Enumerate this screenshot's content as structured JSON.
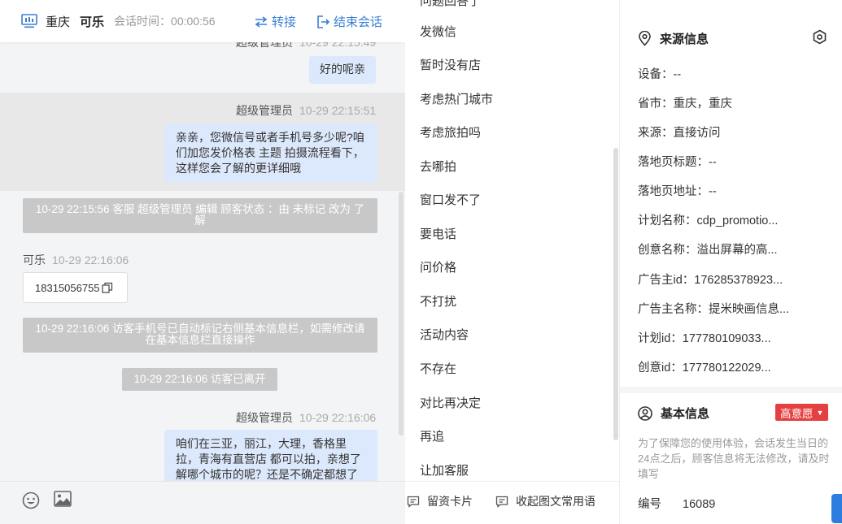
{
  "header": {
    "city": "重庆",
    "visitor": "可乐",
    "session_time": "会话时间：00:00:56",
    "transfer": "转接",
    "end_session": "结束会话"
  },
  "messages": {
    "m0_sender": "超级管理员",
    "m0_time": "10-29 22:15:49",
    "m0_text": "好的呢亲",
    "m1_sender": "超级管理员",
    "m1_time": "10-29 22:15:51",
    "m1_text": "亲亲，您微信号或者手机号多少呢?咱们加您发价格表 主题 拍摄流程看下，这样您会了解的更详细哦",
    "sys1": "10-29 22:15:56 客服 超级管理员 编辑 顾客状态 ：由 未标记 改为 了解",
    "m2_sender": "可乐",
    "m2_time": "10-29 22:16:06",
    "m2_text": "18315056755",
    "sys2": "10-29 22:16:06 访客手机号已自动标记右侧基本信息栏，如需修改请在基本信息栏直接操作",
    "sys3": "10-29 22:16:06 访客已离开",
    "m3_sender": "超级管理员",
    "m3_time": "10-29 22:16:06",
    "m3_text": "咱们在三亚，丽江，大理，香格里拉，青海有直营店 都可以拍，亲想了解哪个城市的呢？还是不确定都想了"
  },
  "quick_replies": [
    "发微信",
    "暂时没有店",
    "考虑热门城市",
    "考虑旅拍吗",
    "去哪拍",
    "窗口发不了",
    "要电话",
    "问价格",
    "不打扰",
    "活动内容",
    "不存在",
    "对比再决定",
    "再追",
    "让加客服"
  ],
  "quick_footer": {
    "leave_card": "留资卡片",
    "collapse": "收起图文常用语"
  },
  "source_info": {
    "title": "来源信息",
    "rows": [
      "设备：--",
      "省市：重庆，重庆",
      "来源：直接访问",
      "落地页标题：--",
      "落地页地址：--",
      "计划名称：cdp_promotio...",
      "创意名称：溢出屏幕的高...",
      "广告主id：176285378923...",
      "广告主名称：提米映画信息...",
      "计划id：177780109033...",
      "创意id：177780122029..."
    ]
  },
  "basic_info": {
    "title": "基本信息",
    "intent": "高意愿",
    "notice": "为了保障您的使用体验，会话发生当日的24点之后，顾客信息将无法修改，请及时填写",
    "id_label": "编号",
    "id_value": "16089"
  },
  "colors": {
    "accent": "#3a7fd5",
    "bubble": "#dce8fb",
    "intent": "#e54040"
  }
}
